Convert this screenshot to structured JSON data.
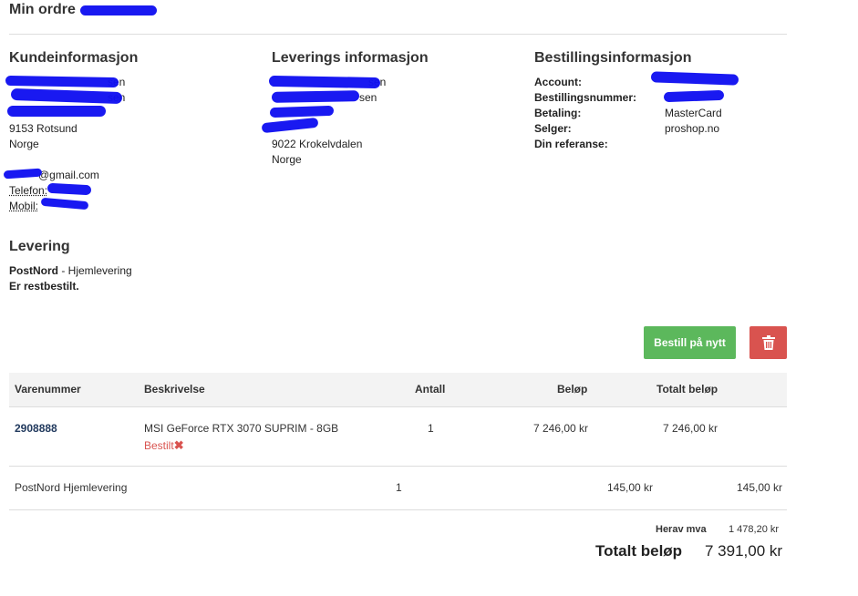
{
  "page": {
    "title": "Min ordre"
  },
  "customer": {
    "heading": "Kundeinformasjon",
    "line_name_suffix": "sen",
    "line_name2_suffix": "sen",
    "line_address": "",
    "postal": "9153 Rotsund",
    "country": "Norge",
    "email": "@gmail.com",
    "phone_label": "Telefon:",
    "mobile_label": "Mobil:"
  },
  "delivery_info": {
    "heading": "Leverings informasjon",
    "line_name_suffix": "sen",
    "line_name2_suffix": "sen",
    "postal": "9022 Krokelvdalen",
    "country": "Norge"
  },
  "order_info": {
    "heading": "Bestillingsinformasjon",
    "rows": [
      {
        "label": "Account:",
        "value": ""
      },
      {
        "label": "Bestillingsnummer:",
        "value": ""
      },
      {
        "label": "Betaling:",
        "value": "MasterCard"
      },
      {
        "label": "Selger:",
        "value": "proshop.no"
      },
      {
        "label": "Din referanse:",
        "value": ""
      }
    ]
  },
  "shipping": {
    "heading": "Levering",
    "carrier": "PostNord",
    "method": " - Hjemlevering",
    "note": "Er restbestilt."
  },
  "actions": {
    "reorder_label": "Bestill på nytt",
    "delete_icon": "trash-icon"
  },
  "table": {
    "headers": {
      "sku": "Varenummer",
      "desc": "Beskrivelse",
      "qty": "Antall",
      "price": "Beløp",
      "total": "Totalt beløp"
    },
    "item": {
      "sku": "2908888",
      "desc": "MSI GeForce RTX 3070 SUPRIM - 8GB",
      "status": "Bestilt",
      "qty": "1",
      "price": "7 246,00 kr",
      "total": "7 246,00 kr"
    },
    "shipping_row": {
      "desc": "PostNord Hjemlevering",
      "qty": "1",
      "price": "145,00 kr",
      "total": "145,00 kr"
    }
  },
  "summary": {
    "vat_label": "Herav mva",
    "vat_value": "1 478,20 kr",
    "total_label": "Totalt beløp",
    "total_value": "7 391,00 kr"
  },
  "colors": {
    "green": "#5cb85c",
    "red": "#d9534f",
    "redaction": "#1010f0"
  }
}
